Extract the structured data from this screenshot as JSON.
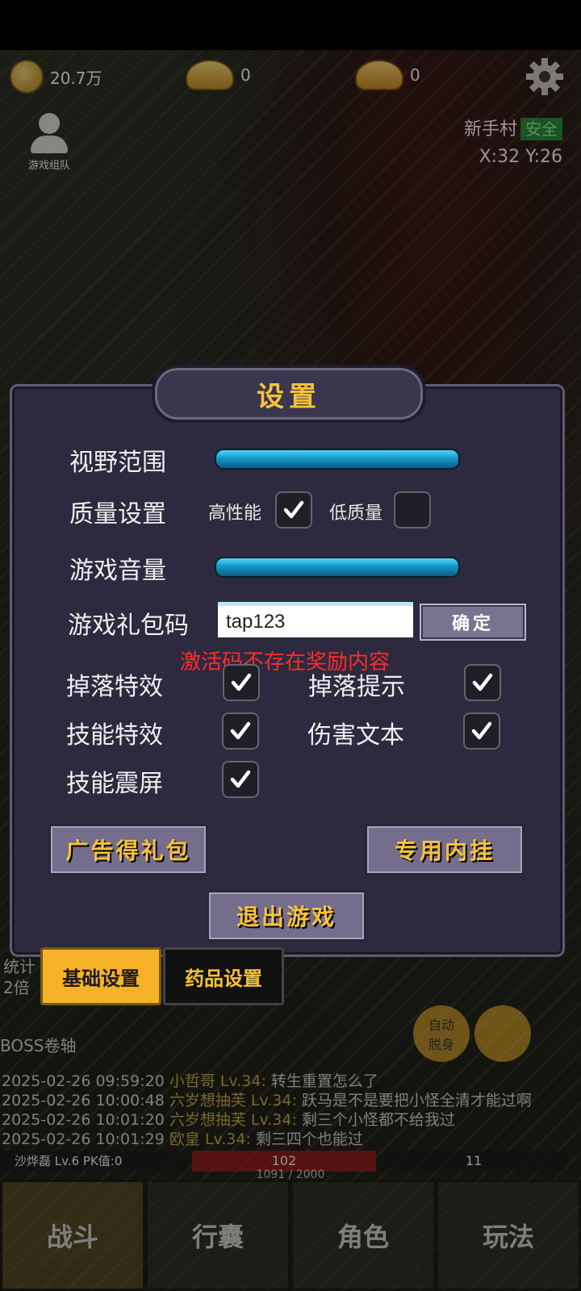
{
  "hud": {
    "coins": "20.7万",
    "ingot1": "0",
    "ingot2": "0",
    "team_label": "游戏组队",
    "map_name": "新手村",
    "map_status": "安全",
    "coords": "X:32 Y:26"
  },
  "settings": {
    "title": "设置",
    "view_range_label": "视野范围",
    "view_range_value": 1.0,
    "quality_label": "质量设置",
    "high_perf_label": "高性能",
    "high_perf_checked": true,
    "low_quality_label": "低质量",
    "low_quality_checked": false,
    "volume_label": "游戏音量",
    "volume_value": 1.0,
    "gift_code_label": "游戏礼包码",
    "gift_code_value": "tap123",
    "confirm_label": "确定",
    "error_message": "激活码不存在奖励内容",
    "options": [
      {
        "label": "掉落特效",
        "checked": true
      },
      {
        "label": "掉落提示",
        "checked": true
      },
      {
        "label": "技能特效",
        "checked": true
      },
      {
        "label": "伤害文本",
        "checked": true
      },
      {
        "label": "技能震屏",
        "checked": true
      }
    ],
    "ad_gift_label": "广告得礼包",
    "plugin_label": "专用内挂",
    "exit_label": "退出游戏"
  },
  "tabs": {
    "basic": "基础设置",
    "potion": "药品设置"
  },
  "background": {
    "stats_label": "统计",
    "double_label": "2倍",
    "boss_scroll": "BOSS卷轴",
    "auto_label": "自动脱身",
    "chat": [
      {
        "time": "2025-02-26 09:59:20",
        "name": "小哲哥 Lv.34:",
        "msg": "转生重置怎么了"
      },
      {
        "time": "2025-02-26 10:00:48",
        "name": "六岁想抽芙 Lv.34:",
        "msg": "跃马是不是要把小怪全清才能过啊"
      },
      {
        "time": "2025-02-26 10:01:20",
        "name": "六岁想抽芙 Lv.34:",
        "msg": "剩三个小怪都不给我过"
      },
      {
        "time": "2025-02-26 10:01:29",
        "name": "欧皇 Lv.34:",
        "msg": "剩三四个也能过"
      }
    ],
    "player": "沙烨磊  Lv.6 PK值:0",
    "hp": "102",
    "mp": "11",
    "exp": "1091 / 2000"
  },
  "nav": [
    "战斗",
    "行囊",
    "角色",
    "玩法"
  ],
  "colors": {
    "accent_gold": "#f7c23a",
    "panel_bg": "#2d2a3f",
    "error_red": "#ff2b2b",
    "slider_blue": "#1597c9"
  }
}
